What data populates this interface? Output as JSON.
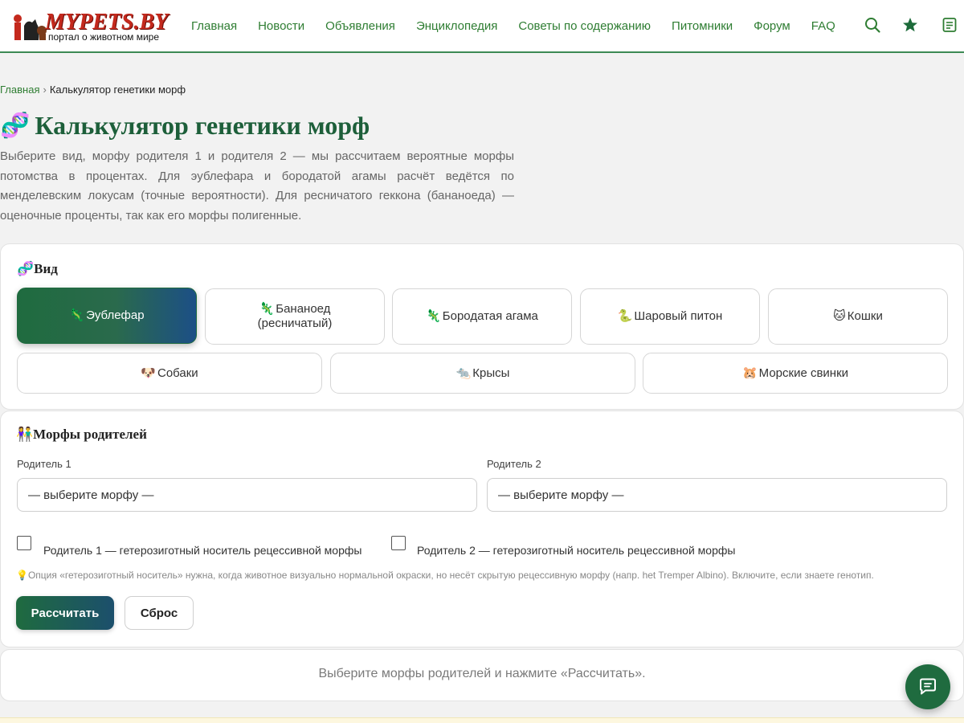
{
  "header": {
    "logo_text": "MYPETS.BY",
    "logo_tagline": "портал о животном мире",
    "nav": [
      {
        "label": "Главная"
      },
      {
        "label": "Новости"
      },
      {
        "label": "Объявления"
      },
      {
        "label": "Энциклопедия"
      },
      {
        "label": "Советы по содержанию"
      },
      {
        "label": "Питомники"
      },
      {
        "label": "Форум"
      },
      {
        "label": "FAQ"
      }
    ],
    "icons": [
      "search-icon",
      "star-icon",
      "notes-icon"
    ],
    "accent_color": "#2e7d32"
  },
  "breadcrumb": {
    "home": "Главная",
    "separator": "›",
    "current": "Калькулятор генетики морф"
  },
  "page": {
    "title_emoji": "🧬",
    "title": "Калькулятор генетики морф",
    "intro": "Выберите вид, морфу родителя 1 и родителя 2 — мы рассчитаем вероятные морфы потомства в процентах. Для эублефара и бородатой агамы расчёт ведётся по менделевским локусам (точные вероятности). Для ресничатого геккона (бананоеда) — оценочные проценты, так как его морфы полигенные."
  },
  "species_section": {
    "title_emoji": "🧬",
    "title": "Вид",
    "options": [
      {
        "emoji": "🦎",
        "label": "Эублефар",
        "active": true
      },
      {
        "emoji": "🦎",
        "label": "Бананоед (ресничатый)",
        "active": false
      },
      {
        "emoji": "🦎",
        "label": "Бородатая агама",
        "active": false
      },
      {
        "emoji": "🐍",
        "label": "Шаровый питон",
        "active": false
      },
      {
        "emoji": "🐱",
        "label": "Кошки",
        "active": false
      },
      {
        "emoji": "🐶",
        "label": "Собаки",
        "active": false
      },
      {
        "emoji": "🐀",
        "label": "Крысы",
        "active": false
      },
      {
        "emoji": "🐹",
        "label": "Морские свинки",
        "active": false
      }
    ]
  },
  "parents_section": {
    "title_emoji": "👫",
    "title": "Морфы родителей",
    "parent1_label": "Родитель 1",
    "parent2_label": "Родитель 2",
    "parent1_value": "— выберите морфу —",
    "parent2_value": "— выберите морфу —",
    "het1_label": "Родитель 1 — гетерозиготный носитель рецессивной морфы",
    "het2_label": "Родитель 2 — гетерозиготный носитель рецессивной морфы",
    "het1_checked": false,
    "het2_checked": false,
    "hint_emoji": "💡",
    "hint": "Опция «гетерозиготный носитель» нужна, когда животное визуально нормальной окраски, но несёт скрытую рецессивную морфу (напр. het Tremper Albino). Включите, если знаете генотип.",
    "calculate_label": "Рассчитать",
    "reset_label": "Сброс"
  },
  "result": {
    "placeholder": "Выберите морфы родителей и нажмите «Рассчитать»."
  },
  "chat": {
    "icon": "chat-icon"
  }
}
